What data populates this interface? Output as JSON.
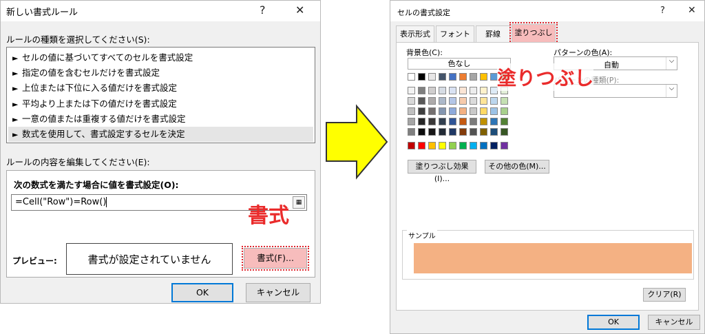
{
  "left_dialog": {
    "title": "新しい書式ルール",
    "help": "?",
    "close": "✕",
    "rule_type_label": "ルールの種類を選択してください(S):",
    "rule_types": [
      "セルの値に基づいてすべてのセルを書式設定",
      "指定の値を含むセルだけを書式設定",
      "上位または下位に入る値だけを書式設定",
      "平均より上または下の値だけを書式設定",
      "一意の値または重複する値だけを書式設定",
      "数式を使用して、書式設定するセルを決定"
    ],
    "edit_label": "ルールの内容を編集してください(E):",
    "formula_label": "次の数式を満たす場合に値を書式設定(O):",
    "formula_value": "=Cell(\"Row\")=Row()",
    "annotation": "書式",
    "preview_label": "プレビュー:",
    "preview_text": "書式が設定されていません",
    "format_button": "書式(F)...",
    "ok": "OK",
    "cancel": "キャンセル"
  },
  "right_dialog": {
    "title": "セルの書式設定",
    "help": "?",
    "close": "✕",
    "tabs": [
      "表示形式",
      "フォント",
      "罫線",
      "塗りつぶし"
    ],
    "bg_label": "背景色(C):",
    "no_color": "色なし",
    "pattern_color_label": "パターンの色(A):",
    "pattern_color_value": "自動",
    "pattern_style_label": "パターンの種類(P):",
    "annotation": "塗りつぶし",
    "fill_effects_button": "塗りつぶし効果(I)...",
    "more_colors_button": "その他の色(M)...",
    "sample_label": "サンプル",
    "sample_color": "#f4b183",
    "clear_button": "クリア(R)",
    "ok": "OK",
    "cancel": "キャンセル",
    "theme_top": [
      "#ffffff",
      "#000000",
      "#e7e6e6",
      "#44546a",
      "#4472c4",
      "#ed7d31",
      "#a5a5a5",
      "#ffc000",
      "#5b9bd5",
      "#70ad47"
    ],
    "theme_rows": [
      [
        "#f2f2f2",
        "#7f7f7f",
        "#d0cece",
        "#d6dce4",
        "#d9e2f3",
        "#fbe5d5",
        "#ededed",
        "#fff2cc",
        "#deebf6",
        "#e2efd9"
      ],
      [
        "#d8d8d8",
        "#595959",
        "#aeabab",
        "#adb9ca",
        "#b4c6e7",
        "#f7cbac",
        "#dbdbdb",
        "#fee599",
        "#bdd7ee",
        "#c5e0b3"
      ],
      [
        "#bfbfbf",
        "#3f3f3f",
        "#757070",
        "#8496b0",
        "#8eaadb",
        "#f4b183",
        "#c9c9c9",
        "#ffd965",
        "#9dc3e6",
        "#a8d08d"
      ],
      [
        "#a5a5a5",
        "#262626",
        "#3a3838",
        "#323f4f",
        "#2f5496",
        "#c55a11",
        "#7b7b7b",
        "#bf9000",
        "#2e75b5",
        "#538135"
      ],
      [
        "#7f7f7f",
        "#0c0c0c",
        "#171616",
        "#222a35",
        "#1f3864",
        "#833c0b",
        "#525252",
        "#7f6000",
        "#1e4e79",
        "#375623"
      ]
    ],
    "standard": [
      "#c00000",
      "#ff0000",
      "#ffc000",
      "#ffff00",
      "#92d050",
      "#00b050",
      "#00b0f0",
      "#0070c0",
      "#002060",
      "#7030a0"
    ]
  }
}
